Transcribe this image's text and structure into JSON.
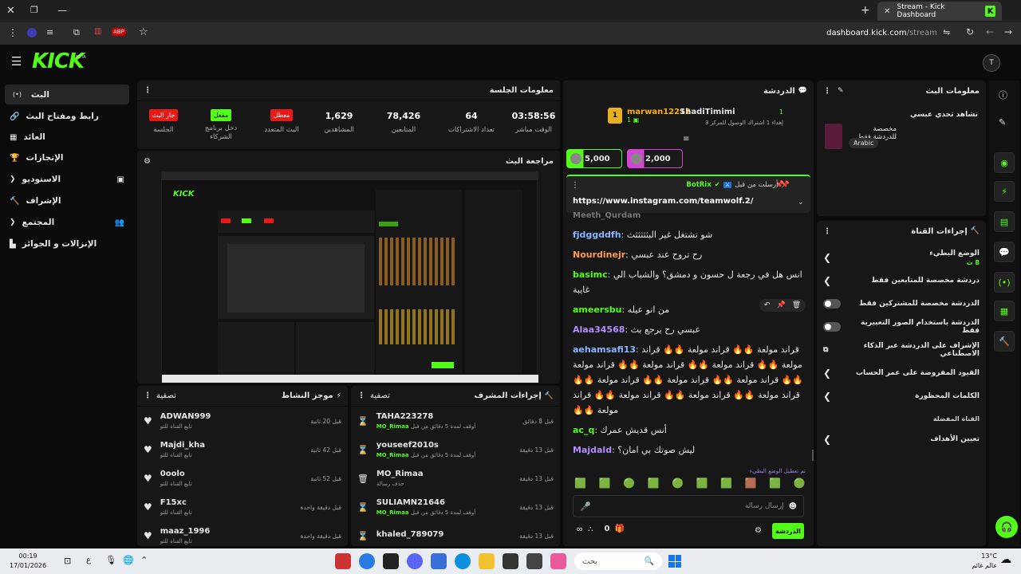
{
  "browser": {
    "tab_title": "Stream - Kick Dashboard",
    "url_domain": "dashboard.kick.com",
    "url_path": "/stream",
    "ext_badge": "ABP"
  },
  "header": {
    "logo": "KICK",
    "beta": "BETA",
    "avatar": "T"
  },
  "sidebar": {
    "items": [
      {
        "label": "البث",
        "icon": "(•)"
      },
      {
        "label": "رابط ومفتاح البث",
        "icon": "🔗"
      },
      {
        "label": "العائد",
        "icon": "▦"
      },
      {
        "label": "الإنجازات",
        "icon": "🏆"
      },
      {
        "label": "الاستوديو",
        "icon": "▣"
      },
      {
        "label": "الإشراف",
        "icon": "🔨"
      },
      {
        "label": "المجتمع",
        "icon": "👥"
      },
      {
        "label": "الإنزالات و الجوائز",
        "icon": "▙"
      }
    ]
  },
  "session": {
    "title": "معلومات الجلسة",
    "stats": [
      {
        "value": "03:58:56",
        "label": "الوقت مباشر"
      },
      {
        "value": "64",
        "label": "تعداد الاشتراكات"
      },
      {
        "value": "78,426",
        "label": "المتابعين"
      },
      {
        "value": "1,629",
        "label": "المشاهدين"
      }
    ],
    "badges": [
      {
        "badge": "معطل",
        "label": "البث المتعدد",
        "color": "red"
      },
      {
        "badge": "مفعل",
        "label": "دخل برنامج الشركاء",
        "color": "green"
      },
      {
        "badge": "جار البث",
        "label": "الجلسة",
        "color": "red"
      }
    ]
  },
  "preview": {
    "title": "مراجعة البث"
  },
  "activity": {
    "title": "موجز النشاط",
    "filter": "تصفية",
    "items": [
      {
        "user": "ADWAN999",
        "sub": "تابع القناة للتو",
        "time": "قبل 20 ثانية",
        "icon": "heart"
      },
      {
        "user": "Majdi_kha",
        "sub": "تابع القناة للتو",
        "time": "قبل 42 ثانية",
        "icon": "heart"
      },
      {
        "user": "0oolo",
        "sub": "تابع القناة للتو",
        "time": "قبل 52 ثانية",
        "icon": "heart"
      },
      {
        "user": "F15xc",
        "sub": "تابع القناة للتو",
        "time": "قبل دقيقة واحدة",
        "icon": "heart"
      },
      {
        "user": "maaz_1996",
        "sub": "تابع القناة للتو",
        "time": "قبل دقيقة واحدة",
        "icon": "heart"
      }
    ]
  },
  "modactions": {
    "title": "إجراءات المشرف",
    "filter": "تصفية",
    "items": [
      {
        "user": "TAHA223278",
        "sub": "أوقف لمدة 5 دقائق من قبل",
        "mod": "MO_Rimaa",
        "time": "قبل 8 دقائق",
        "icon": "hourglass"
      },
      {
        "user": "youseef2010s",
        "sub": "أوقف لمدة 5 دقائق من قبل",
        "mod": "MO_Rimaa",
        "time": "قبل 13 دقيقة",
        "icon": "hourglass"
      },
      {
        "user": "MO_Rimaa",
        "sub": "حذف رسالة",
        "mod": "",
        "time": "قبل 13 دقيقة",
        "icon": "trash"
      },
      {
        "user": "SULIAMN21646",
        "sub": "أوقف لمدة 5 دقائق من قبل",
        "mod": "MO_Rimaa",
        "time": "قبل 13 دقيقة",
        "icon": "hourglass"
      },
      {
        "user": "khaled_789079",
        "sub": "",
        "mod": "",
        "time": "قبل 13 دقيقة",
        "icon": "hourglass"
      }
    ]
  },
  "chat": {
    "title": "الدردشة",
    "top_left_user": "marwan12212",
    "top_left_count": "1",
    "top_right_user": "ShadiTimimi",
    "top_right_count": "1",
    "top_right_sub": "إهداء 1 اشتراك الوصول للمركز 3",
    "gift1": "5,000",
    "gift2": "2,000",
    "pinned_by": "أرسلت من قبل",
    "pinned_user": "BotRix",
    "pinned_link": "https://www.instagram.com/teamwolf.2/",
    "cut_user": "Meeth_Qurdam",
    "messages": [
      {
        "user": "fjdggddfh",
        "text": "شو تشتغل غير البثثثثثث",
        "color": "#8ab4ff"
      },
      {
        "user": "Nourdinejr",
        "text": "رح تروح عند عبسي",
        "color": "#ff9a4a"
      },
      {
        "user": "basimc",
        "text": "انس هل في رجعة ل حسون و دمشق؟ والشباب الي غايبة",
        "color": "#53fc18"
      },
      {
        "user": "ameersbu",
        "text": "من انو عيله",
        "color": "#53fc18"
      },
      {
        "user": "Alaa34568",
        "text": "عبسي رح يرجع بث",
        "color": "#b48cff"
      },
      {
        "user": "aehamsafi13",
        "text": "قراند مولعة 🔥🔥 قراند مولعة 🔥🔥 قراند مولعة 🔥🔥 قراند مولعة 🔥🔥 قراند مولعة 🔥🔥 قراند مولعة 🔥🔥 قراند مولعة 🔥🔥 قراند مولعة 🔥🔥 قراند مولعة 🔥🔥 قراند مولعة 🔥🔥 قراند مولعة 🔥🔥 قراند مولعة 🔥🔥 قراند مولعة 🔥🔥",
        "color": "#8ab4ff"
      },
      {
        "user": "ac_q",
        "text": "أنس قديش عمرك",
        "color": "#53fc18"
      },
      {
        "user": "Majdald",
        "text": "ليش صوتك بي امان؟",
        "color": "#b48cff"
      }
    ],
    "emote_mode_note": "تم تعطيل الوضع البطيء",
    "input_placeholder": "إرسال رسالة",
    "send": "الدردشة",
    "points": "0"
  },
  "stream_info": {
    "title": "معلومات البث",
    "stream_title": "نشاهد تحدي عبسي",
    "category": "مخصصة للدردشة فقط",
    "language": "Arabic"
  },
  "channel_actions": {
    "title": "إجراءات القناة",
    "items": [
      {
        "label": "الوضع البطيء",
        "sub": "8 ث",
        "type": "chevron"
      },
      {
        "label": "دردشة مخصصة للمتابعين فقط",
        "type": "chevron"
      },
      {
        "label": "الدردشة مخصصة للمشتركين فقط",
        "type": "toggle"
      },
      {
        "label": "الدردشة باستخدام الصور التعبيرية فقط",
        "type": "toggle"
      },
      {
        "label": "الإشراف على الدردشة عبر الذكاء الاصطناعي",
        "type": "external"
      },
      {
        "label": "القيود المفروضة على عمر الحساب",
        "type": "chevron"
      },
      {
        "label": "الكلمات المحظورة",
        "type": "chevron"
      }
    ],
    "section": "القناة المفضلة",
    "last": "تعيين الأهداف"
  },
  "taskbar": {
    "time": "00:19",
    "date": "17/01/2026",
    "search": "بحث",
    "weather_temp": "13°C",
    "weather_label": "عالم غائم",
    "lang": "ع"
  },
  "colors": {
    "accent": "#53fc18",
    "red": "#e91916",
    "panel": "#171717"
  }
}
